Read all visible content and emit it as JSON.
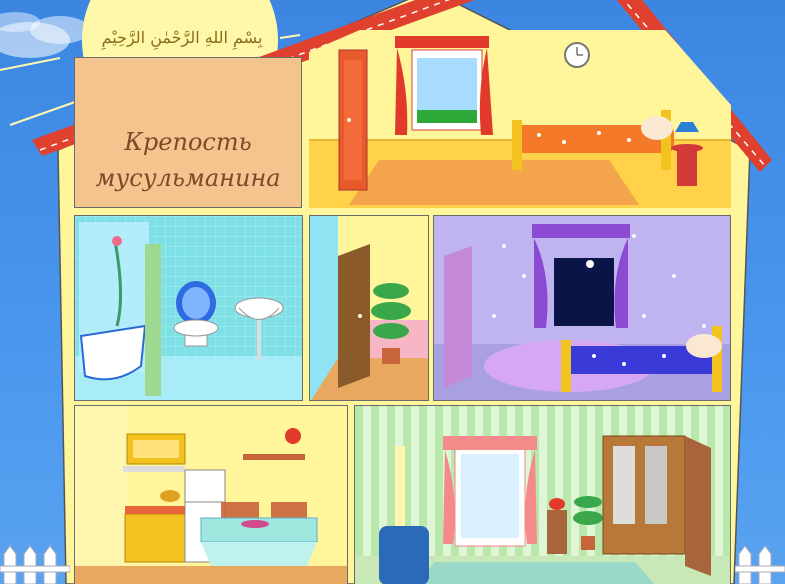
{
  "sign": {
    "line1": "Крепость",
    "line2": "мусульманина"
  },
  "calligraphy": {
    "text": "بِسْمِ اللهِ الرَّحْمٰنِ الرَّحِيْمِ"
  },
  "colors": {
    "sky": "#3d8be6",
    "sun": "#fff8a8",
    "roof": "#e0402e",
    "wall": "#fff59b",
    "sign_bg": "#f4c48f"
  },
  "rooms": [
    {
      "id": "bedroom-attic"
    },
    {
      "id": "bathroom"
    },
    {
      "id": "hallway"
    },
    {
      "id": "kids-bedroom"
    },
    {
      "id": "kitchen"
    },
    {
      "id": "living-room"
    }
  ]
}
